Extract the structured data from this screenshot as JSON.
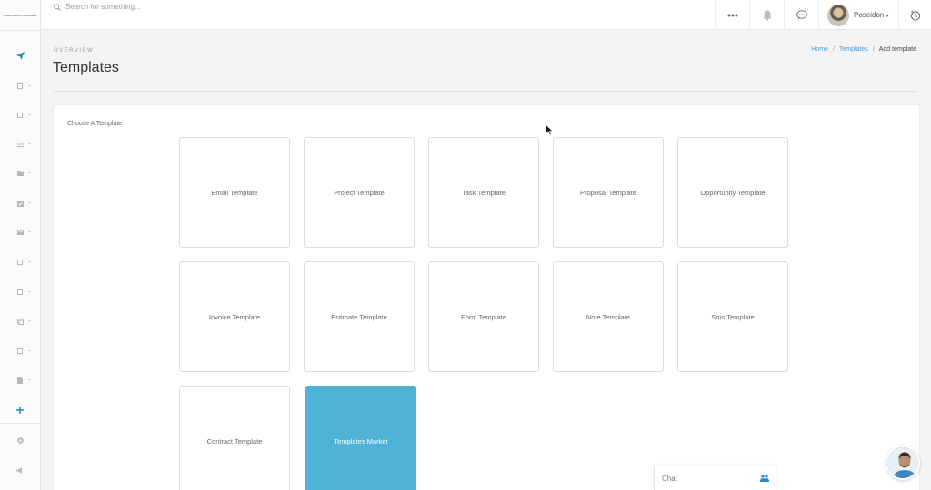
{
  "topbar": {
    "search_placeholder": "Search for something...",
    "user_name": "Poseidon"
  },
  "logo": {
    "text_left": "DIRBUSINESS",
    "text_right": "Dashboard"
  },
  "sidebar": {
    "items": [
      {
        "icon": "paper-plane-icon"
      },
      {
        "icon": "square-icon"
      },
      {
        "icon": "square-icon"
      },
      {
        "icon": "list-icon"
      },
      {
        "icon": "folder-icon"
      },
      {
        "icon": "check-square-icon"
      },
      {
        "icon": "envelope-icon"
      },
      {
        "icon": "square-icon"
      },
      {
        "icon": "square-icon"
      },
      {
        "icon": "copy-icon"
      },
      {
        "icon": "square-icon"
      },
      {
        "icon": "file-icon"
      },
      {
        "icon": "plus-icon"
      },
      {
        "icon": "support-icon"
      },
      {
        "icon": "megaphone-icon"
      }
    ]
  },
  "page": {
    "overview_label": "OVERVIEW",
    "title": "Templates",
    "breadcrumb": {
      "home": "Home",
      "sep1": "/",
      "templates": "Templates",
      "sep2": "/",
      "current": "Add template"
    }
  },
  "card": {
    "label": "Choose A Template",
    "tiles": [
      "Email Template",
      "Project Template",
      "Task Template",
      "Proposal Template",
      "Opportunity Template",
      "Invoice Template",
      "Estimate Template",
      "Form Template",
      "Note Template",
      "Sms Template",
      "Contract Template",
      "Templates Market"
    ]
  },
  "chat": {
    "label": "Chat"
  },
  "colors": {
    "accent": "#4a9fd3",
    "market_tile": "#4fb3d6",
    "primary_icon": "#2d8bc9"
  }
}
